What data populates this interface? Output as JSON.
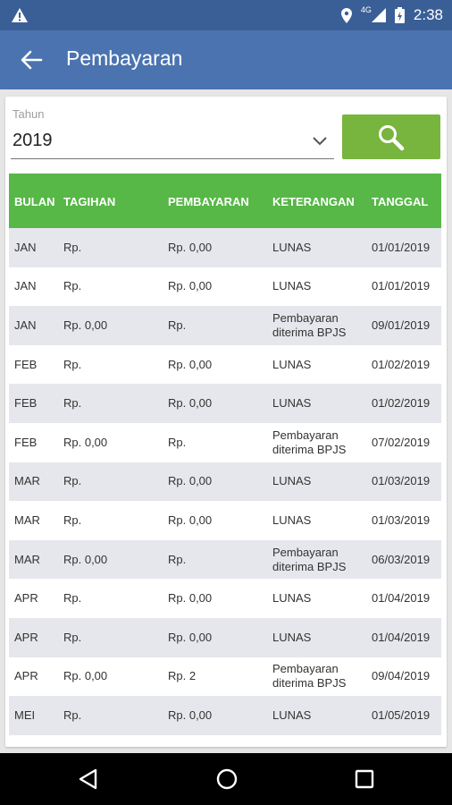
{
  "status_bar": {
    "time": "2:38",
    "network": "4G",
    "icons": [
      "warning-icon",
      "location-icon",
      "signal-icon",
      "battery-icon"
    ]
  },
  "app_bar": {
    "title": "Pembayaran",
    "back_icon": "arrow-left-icon"
  },
  "filter": {
    "year_label": "Tahun",
    "year_value": "2019",
    "search_icon": "search-icon",
    "accent_color": "#78b53f"
  },
  "table": {
    "header_color": "#57b747",
    "headers": {
      "bulan": "BULAN",
      "tagihan": "TAGIHAN",
      "pembayaran": "PEMBAYARAN",
      "keterangan": "KETERANGAN",
      "tanggal": "TANGGAL"
    },
    "rows": [
      {
        "bulan": "JAN",
        "tagihan": "Rp.",
        "pembayaran": "Rp. 0,00",
        "keterangan": "LUNAS",
        "tanggal": "01/01/2019"
      },
      {
        "bulan": "JAN",
        "tagihan": "Rp.",
        "pembayaran": "Rp. 0,00",
        "keterangan": "LUNAS",
        "tanggal": "01/01/2019"
      },
      {
        "bulan": "JAN",
        "tagihan": "Rp. 0,00",
        "pembayaran": "Rp.",
        "keterangan": "Pembayaran diterima BPJS",
        "tanggal": "09/01/2019"
      },
      {
        "bulan": "FEB",
        "tagihan": "Rp.",
        "pembayaran": "Rp. 0,00",
        "keterangan": "LUNAS",
        "tanggal": "01/02/2019"
      },
      {
        "bulan": "FEB",
        "tagihan": "Rp.",
        "pembayaran": "Rp. 0,00",
        "keterangan": "LUNAS",
        "tanggal": "01/02/2019"
      },
      {
        "bulan": "FEB",
        "tagihan": "Rp. 0,00",
        "pembayaran": "Rp.",
        "keterangan": "Pembayaran diterima BPJS",
        "tanggal": "07/02/2019"
      },
      {
        "bulan": "MAR",
        "tagihan": "Rp.",
        "pembayaran": "Rp. 0,00",
        "keterangan": "LUNAS",
        "tanggal": "01/03/2019"
      },
      {
        "bulan": "MAR",
        "tagihan": "Rp.",
        "pembayaran": "Rp. 0,00",
        "keterangan": "LUNAS",
        "tanggal": "01/03/2019"
      },
      {
        "bulan": "MAR",
        "tagihan": "Rp. 0,00",
        "pembayaran": "Rp.",
        "keterangan": "Pembayaran diterima BPJS",
        "tanggal": "06/03/2019"
      },
      {
        "bulan": "APR",
        "tagihan": "Rp.",
        "pembayaran": "Rp. 0,00",
        "keterangan": "LUNAS",
        "tanggal": "01/04/2019"
      },
      {
        "bulan": "APR",
        "tagihan": "Rp.",
        "pembayaran": "Rp. 0,00",
        "keterangan": "LUNAS",
        "tanggal": "01/04/2019"
      },
      {
        "bulan": "APR",
        "tagihan": "Rp. 0,00",
        "pembayaran": "Rp. 2",
        "keterangan": "Pembayaran diterima BPJS",
        "tanggal": "09/04/2019"
      },
      {
        "bulan": "MEI",
        "tagihan": "Rp.",
        "pembayaran": "Rp. 0,00",
        "keterangan": "LUNAS",
        "tanggal": "01/05/2019"
      }
    ]
  },
  "nav_bar": {
    "back": "triangle-back-icon",
    "home": "circle-home-icon",
    "recents": "square-recents-icon"
  }
}
